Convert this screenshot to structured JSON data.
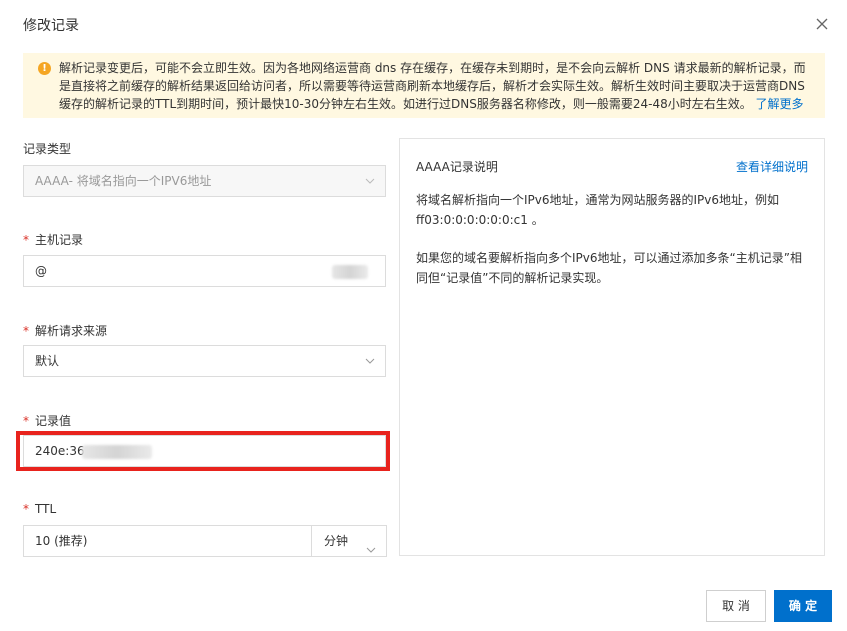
{
  "dialog": {
    "title": "修改记录"
  },
  "notice": {
    "text": "解析记录变更后，可能不会立即生效。因为各地网络运营商 dns 存在缓存，在缓存未到期时，是不会向云解析 DNS 请求最新的解析记录，而是直接将之前缓存的解析结果返回给访问者，所以需要等待运营商刷新本地缓存后，解析才会实际生效。解析生效时间主要取决于运营商DNS缓存的解析记录的TTL到期时间，预计最快10-30分钟左右生效。如进行过DNS服务器名称修改，则一般需要24-48小时左右生效。",
    "link": "了解更多"
  },
  "form": {
    "record_type": {
      "label": "记录类型",
      "value": "AAAA- 将域名指向一个IPV6地址"
    },
    "host": {
      "label": "主机记录",
      "value": "@"
    },
    "line": {
      "label": "解析请求来源",
      "value": "默认"
    },
    "value": {
      "label": "记录值",
      "value": "240e:36"
    },
    "ttl": {
      "label": "TTL",
      "value": "10 (推荐)",
      "unit": "分钟"
    },
    "required_mark": "*"
  },
  "info": {
    "title": "AAAA记录说明",
    "link": "查看详细说明",
    "p1": "将域名解析指向一个IPv6地址，通常为网站服务器的IPv6地址，例如ff03:0:0:0:0:0:0:c1 。",
    "p2": "如果您的域名要解析指向多个IPv6地址，可以通过添加多条“主机记录”相同但“记录值”不同的解析记录实现。"
  },
  "buttons": {
    "cancel": "取 消",
    "ok": "确 定"
  },
  "colors": {
    "primary": "#0070cc",
    "warning": "#f5a623",
    "notice_bg": "#fff8e1",
    "highlight": "#e8231d",
    "required": "#d93026"
  }
}
